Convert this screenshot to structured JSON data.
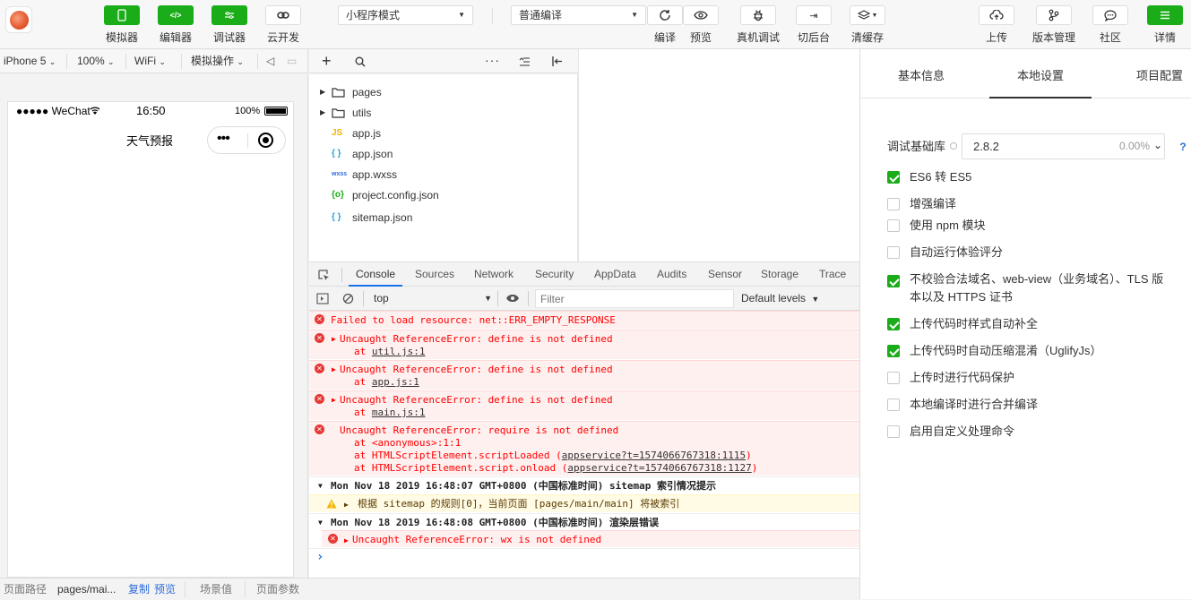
{
  "toolbar": {
    "left_buttons": [
      {
        "label": "模拟器",
        "icon": "phone-icon"
      },
      {
        "label": "编辑器",
        "icon": "code-icon"
      },
      {
        "label": "调试器",
        "icon": "sliders-icon"
      },
      {
        "label": "云开发",
        "icon": "cloud-link-icon"
      }
    ],
    "mode_select": "小程序模式",
    "compile_select": "普通编译",
    "mid_buttons": [
      {
        "label": "编译",
        "icon": "refresh-icon"
      },
      {
        "label": "预览",
        "icon": "eye-icon"
      },
      {
        "label": "真机调试",
        "icon": "bug-icon"
      },
      {
        "label": "切后台",
        "icon": "switch-icon"
      },
      {
        "label": "清缓存",
        "icon": "layers-icon"
      }
    ],
    "right_buttons": [
      {
        "label": "上传",
        "icon": "upload-icon"
      },
      {
        "label": "版本管理",
        "icon": "branch-icon"
      },
      {
        "label": "社区",
        "icon": "chat-icon"
      },
      {
        "label": "详情",
        "icon": "menu-icon"
      }
    ]
  },
  "simbar": {
    "device": "iPhone 5",
    "zoom": "100%",
    "network": "WiFi",
    "operate": "模拟操作"
  },
  "phone": {
    "carrier": "●●●●● WeChat",
    "time": "16:50",
    "battery": "100%",
    "nav_title": "天气预报",
    "capsule_dots": "•••"
  },
  "filetree": [
    {
      "name": "pages",
      "type": "folder",
      "icon": "folder-icon"
    },
    {
      "name": "utils",
      "type": "folder",
      "icon": "folder-icon"
    },
    {
      "name": "app.js",
      "type": "file",
      "icon": "js-icon",
      "glyph": "JS",
      "color": "#f0b400"
    },
    {
      "name": "app.json",
      "type": "file",
      "icon": "json-icon",
      "glyph": "{ }",
      "color": "#2d9cdb"
    },
    {
      "name": "app.wxss",
      "type": "file",
      "icon": "wxss-icon",
      "glyph": "wxss",
      "color": "#2d6cdb"
    },
    {
      "name": "project.config.json",
      "type": "file",
      "icon": "config-icon",
      "glyph": "{o}",
      "color": "#1aad19"
    },
    {
      "name": "sitemap.json",
      "type": "file",
      "icon": "json-icon",
      "glyph": "{ }",
      "color": "#2d9cdb"
    }
  ],
  "devtools": {
    "tabs": [
      "Console",
      "Sources",
      "Network",
      "Security",
      "AppData",
      "Audits",
      "Sensor",
      "Storage",
      "Trace"
    ],
    "active_tab": "Console",
    "context": "top",
    "filter_placeholder": "Filter",
    "levels": "Default levels"
  },
  "console": {
    "e1": "Failed to load resource: net::ERR_EMPTY_RESPONSE",
    "e2": "Uncaught ReferenceError: define is not defined",
    "e2_at": "at ",
    "e2_link": "util.js:1",
    "e3": "Uncaught ReferenceError: define is not defined",
    "e3_link": "app.js:1",
    "e4": "Uncaught ReferenceError: define is not defined",
    "e4_link": "main.js:1",
    "e5": "Uncaught ReferenceError: require is not defined",
    "e5_l1": "at <anonymous>:1:1",
    "e5_l2": "at HTMLScriptElement.scriptLoaded (",
    "e5_l2_link": "appservice?t=1574066767318:1115",
    "e5_l3": "at HTMLScriptElement.script.onload (",
    "e5_l3_link": "appservice?t=1574066767318:1127",
    "close_paren": ")",
    "g1": "Mon Nov 18 2019 16:48:07 GMT+0800 (中国标准时间) sitemap 索引情况提示",
    "w1": "根据 sitemap 的规则[0]，当前页面 [pages/main/main] 将被索引",
    "g2": "Mon Nov 18 2019 16:48:08 GMT+0800 (中国标准时间) 渲染层错误",
    "e6": "Uncaught ReferenceError: wx is not defined",
    "prompt": "›"
  },
  "bottombar": {
    "path_label": "页面路径",
    "path_value": "pages/mai...",
    "copy": "复制",
    "preview": "预览",
    "scene": "场景值",
    "params": "页面参数"
  },
  "settings": {
    "tabs": [
      "基本信息",
      "本地设置",
      "项目配置"
    ],
    "active_tab": "本地设置",
    "lib_label": "调试基础库",
    "lib_version": "2.8.2",
    "lib_percent": "0.00%",
    "help": "?",
    "options": [
      {
        "label": "ES6 转 ES5",
        "checked": true
      },
      {
        "label": "增强编译",
        "checked": false
      },
      {
        "label": "使用 npm 模块",
        "checked": false
      },
      {
        "label": "自动运行体验评分",
        "checked": false
      },
      {
        "label": "不校验合法域名、web-view（业务域名）、TLS 版",
        "label2": "本以及 HTTPS 证书",
        "checked": true
      },
      {
        "label": "上传代码时样式自动补全",
        "checked": true
      },
      {
        "label": "上传代码时自动压缩混淆（UglifyJs）",
        "checked": true
      },
      {
        "label": "上传时进行代码保护",
        "checked": false
      },
      {
        "label": "本地编译时进行合并编译",
        "checked": false
      },
      {
        "label": "启用自定义处理命令",
        "checked": false
      }
    ]
  }
}
